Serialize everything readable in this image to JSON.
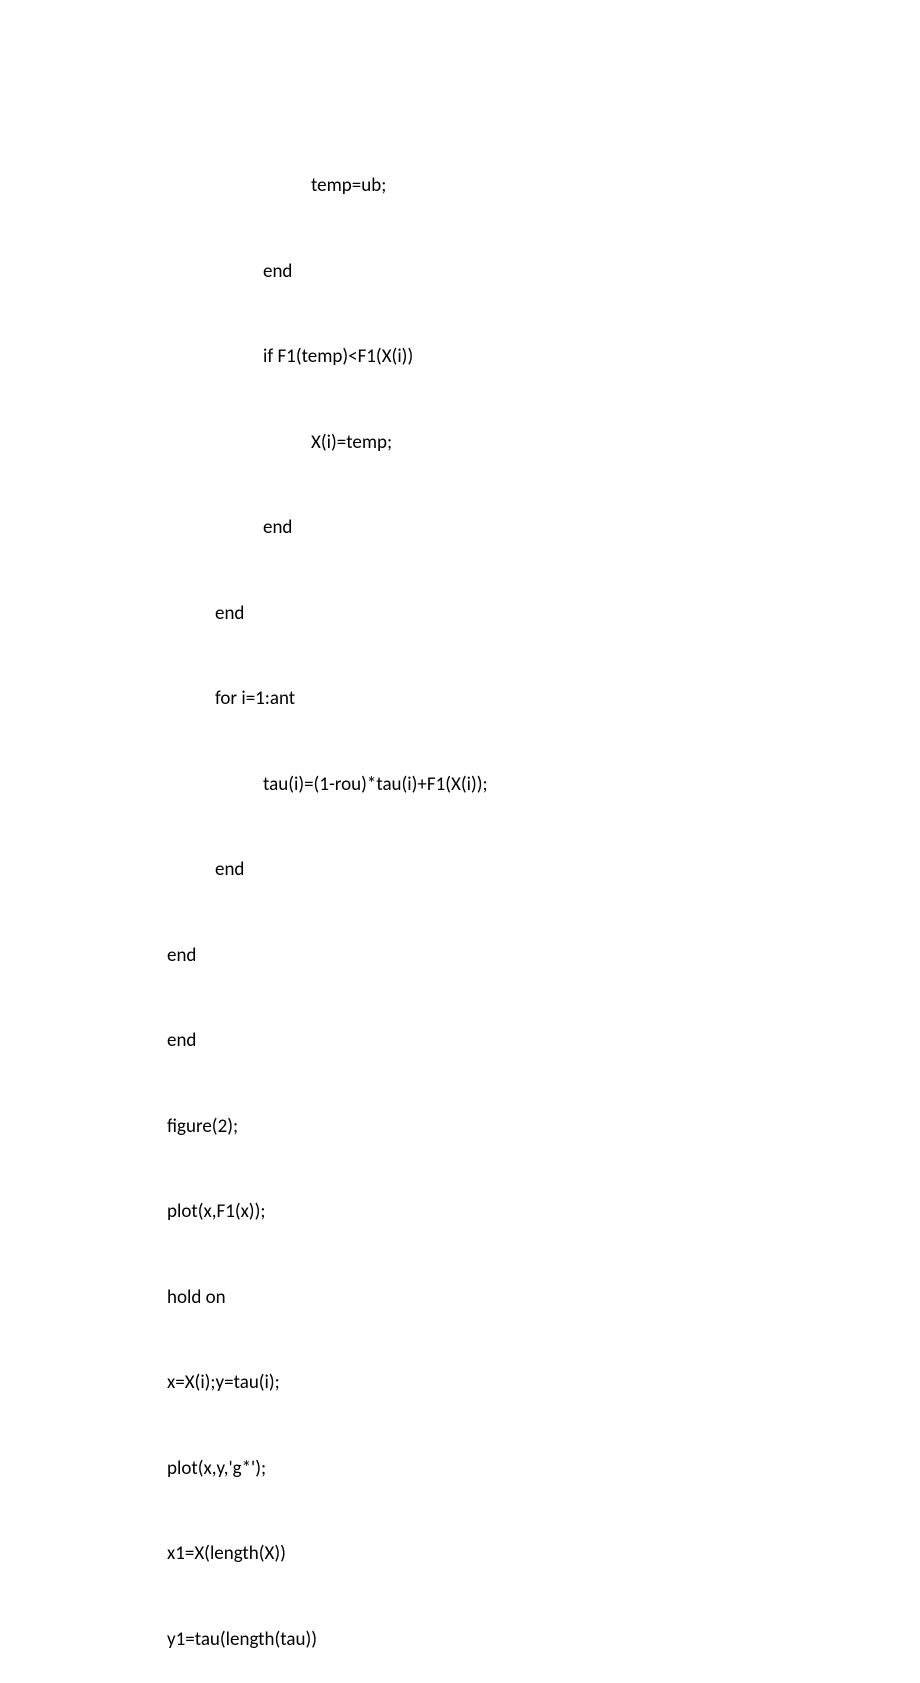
{
  "code": {
    "lines": [
      {
        "indent": 4,
        "text": "temp=ub;"
      },
      {
        "indent": 3,
        "text": "end"
      },
      {
        "indent": 3,
        "text": "if F1(temp)<F1(X(i))"
      },
      {
        "indent": 4,
        "text": "X(i)=temp;"
      },
      {
        "indent": 3,
        "text": "end"
      },
      {
        "indent": 2,
        "text": "end"
      },
      {
        "indent": 2,
        "text": "for i=1:ant"
      },
      {
        "indent": 3,
        "text": "tau(i)=(1-rou)*tau(i)+F1(X(i));"
      },
      {
        "indent": 2,
        "text": "end"
      },
      {
        "indent": 1,
        "text": "end"
      },
      {
        "indent": 1,
        "text": "end"
      },
      {
        "indent": 1,
        "text": "figure(2);"
      },
      {
        "indent": 1,
        "text": "plot(x,F1(x));"
      },
      {
        "indent": 1,
        "text": "hold on"
      },
      {
        "indent": 1,
        "text": "x=X(i);y=tau(i);"
      },
      {
        "indent": 1,
        "text": "plot(x,y,'g*');"
      },
      {
        "indent": 1,
        "text": "x1=X(length(X))"
      },
      {
        "indent": 1,
        "text": "y1=tau(length(tau))"
      }
    ]
  }
}
